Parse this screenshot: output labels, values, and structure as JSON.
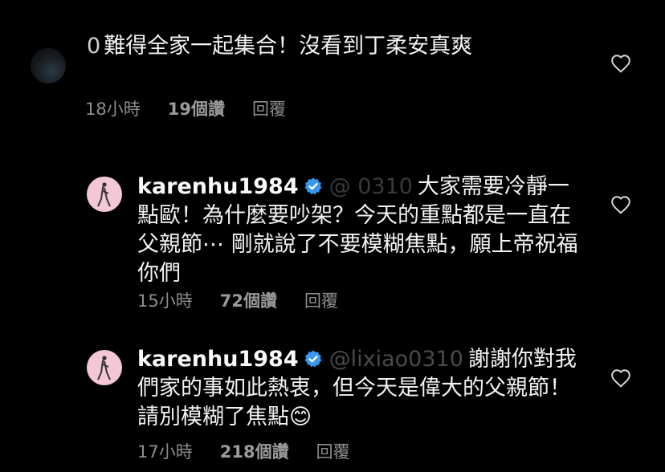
{
  "comments": [
    {
      "mention": "0",
      "text": "難得全家一起集合！沒看到丁柔安真爽",
      "time": "18小時",
      "likes": "19個讚",
      "reply": "回覆"
    },
    {
      "username": "karenhu1984",
      "mention": "@ 0310",
      "text": "大家需要冷靜一點歐！為什麼要吵架？今天的重點都是一直在父親節⋯ 剛就說了不要模糊焦點，願上帝祝福你們",
      "time": "15小時",
      "likes": "72個讚",
      "reply": "回覆"
    },
    {
      "username": "karenhu1984",
      "mention": "@lixiao0310",
      "text": "謝謝你對我們家的事如此熱衷，但今天是偉大的父親節！請別模糊了焦點😊",
      "time": "17小時",
      "likes": "218個讚",
      "reply": "回覆"
    }
  ],
  "icons": {
    "verified_color": "#3897f0",
    "heart": "heart-outline-icon"
  }
}
